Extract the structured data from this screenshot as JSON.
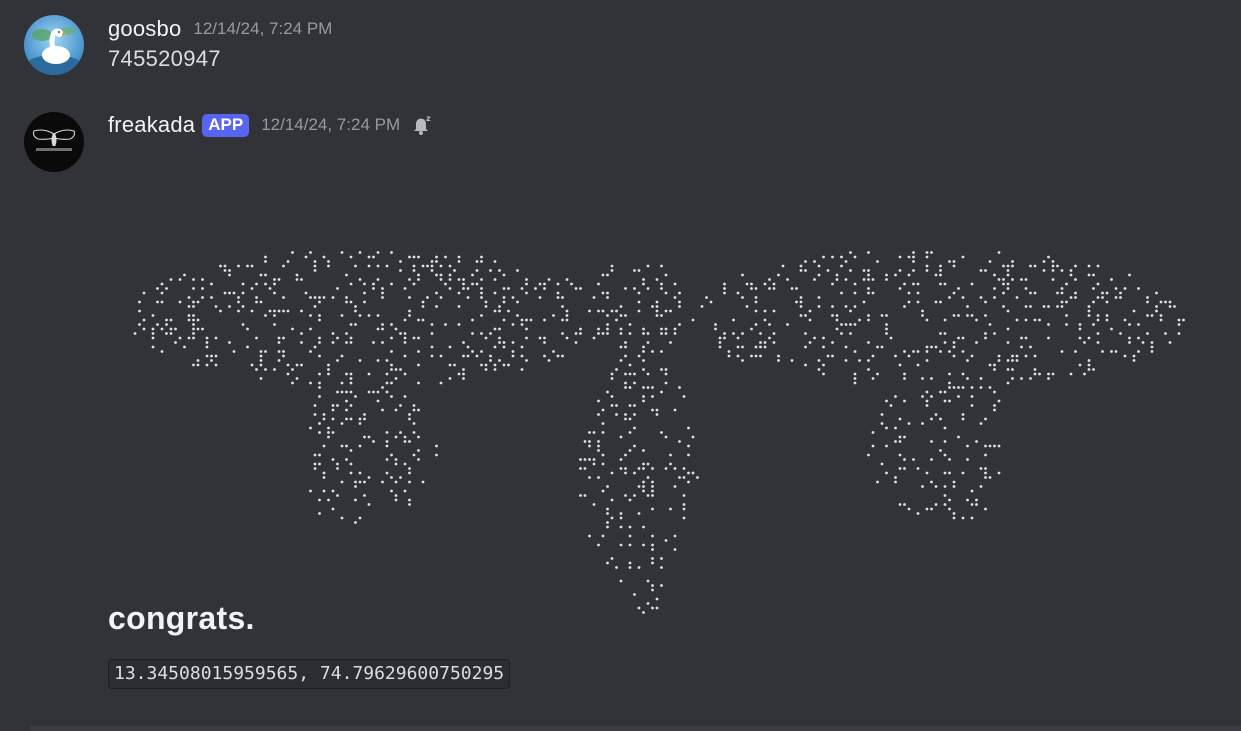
{
  "messages": [
    {
      "username": "goosbo",
      "timestamp": "12/14/24, 7:24 PM",
      "content": "745520947",
      "avatar_icon": "goose-avatar"
    },
    {
      "username": "freakada",
      "badge": "APP",
      "timestamp": "12/14/24, 7:24 PM",
      "status_icon": "bell-snooze-icon",
      "avatar_icon": "cicada-avatar",
      "art_description_icon": "braille-cicada-art",
      "heading": "congrats.",
      "code": "13.34508015959565, 74.79629600750295"
    }
  ],
  "colors": {
    "background": "#313338",
    "username": "#f2f3f5",
    "text": "#dbdee1",
    "timestamp": "#949ba4",
    "badge": "#5865f2",
    "code_bg": "#2b2d31"
  }
}
